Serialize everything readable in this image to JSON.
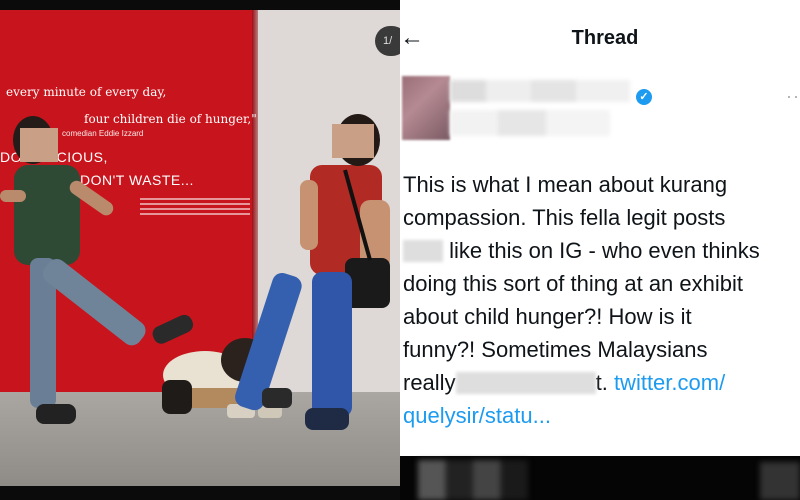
{
  "photo": {
    "quote_line1": "every minute of every day,",
    "quote_line2": "four children die of hunger,\"",
    "quote_attribution": "comedian Eddie Izzard",
    "wall_line1": "DO    PRECIOUS,",
    "wall_line2": "DON'T WASTE...",
    "image_counter": "1/"
  },
  "thread": {
    "back_icon": "←",
    "title": "Thread",
    "verified_icon": "✓",
    "more_icon": "··",
    "tweet": {
      "line1": "This is what I mean about kurang",
      "line2": "compassion. This fella legit posts",
      "line3_after_redaction": "like this on IG - who even thinks",
      "line4": "doing this sort of thing at an exhibit",
      "line5": "about child hunger?! How is it",
      "line6": "funny?! Sometimes Malaysians",
      "line7_start": "really",
      "line7_end": "t.",
      "link_part1": "twitter.com/",
      "link_part2": "quelysir/statu..."
    }
  },
  "colors": {
    "accent_blue": "#1d9bf0",
    "wall_red": "#c8141c"
  }
}
